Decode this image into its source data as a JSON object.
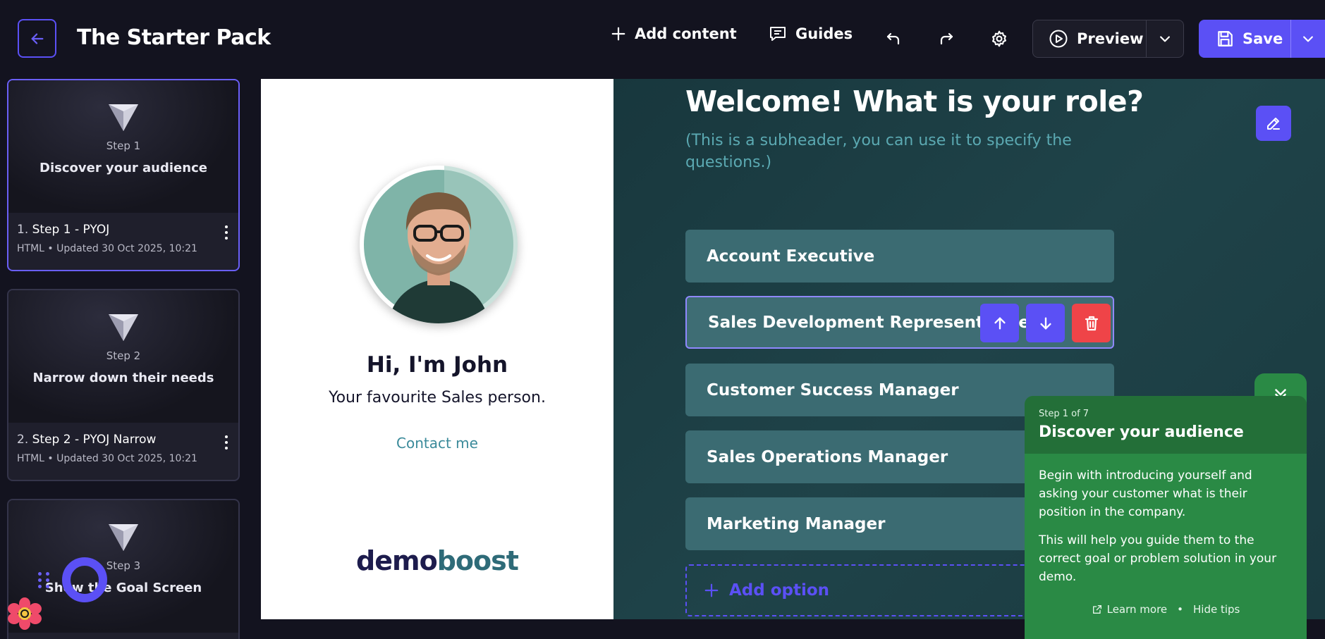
{
  "app": {
    "title": "The Starter Pack"
  },
  "toolbar": {
    "add_content": "Add content",
    "guides": "Guides",
    "preview": "Preview",
    "save": "Save"
  },
  "sidebar": {
    "steps": [
      {
        "thumb_step": "Step 1",
        "thumb_name": "Discover your audience",
        "index": "1.",
        "title": "Step 1 - PYOJ",
        "meta": "HTML • Updated 30 Oct 2025, 10:21"
      },
      {
        "thumb_step": "Step 2",
        "thumb_name": "Narrow down their needs",
        "index": "2.",
        "title": "Step 2 - PYOJ Narrow",
        "meta": "HTML • Updated 30 Oct 2025, 10:21"
      },
      {
        "thumb_step": "Step 3",
        "thumb_name": "Show the Goal Screen"
      }
    ]
  },
  "profile": {
    "greeting": "Hi, I'm John",
    "tagline": "Your favourite Sales person.",
    "contact": "Contact me",
    "brand_a": "demo",
    "brand_b": "boost"
  },
  "question": {
    "title": "Welcome! What is your role?",
    "subheader": "(This is a subheader, you can use it to specify the questions.)",
    "options": [
      "Account Executive",
      "Sales Development Representative",
      "Customer Success Manager",
      "Sales Operations Manager",
      "Marketing Manager"
    ],
    "add_option": "Add option"
  },
  "tips": {
    "step": "Step 1 of 7",
    "title": "Discover your audience",
    "para1": "Begin with introducing yourself and asking your customer what is their position in the company.",
    "para2": "This will help you guide them to the correct goal or problem solution in your demo.",
    "learn_more": "Learn more",
    "separator": "•",
    "hide_tips": "Hide tips"
  },
  "colors": {
    "accent": "#5b50f5",
    "tips_green": "#2a8a45",
    "option_bg": "#3b6b72",
    "danger": "#ef4448"
  },
  "icons": [
    "arrow-left-icon",
    "plus-icon",
    "chat-icon",
    "undo-icon",
    "redo-icon",
    "gear-icon",
    "play-icon",
    "chevron-down-icon",
    "save-icon",
    "pencil-icon",
    "arrow-up-icon",
    "arrow-down-icon",
    "trash-icon",
    "external-link-icon",
    "chevrons-down-icon"
  ]
}
